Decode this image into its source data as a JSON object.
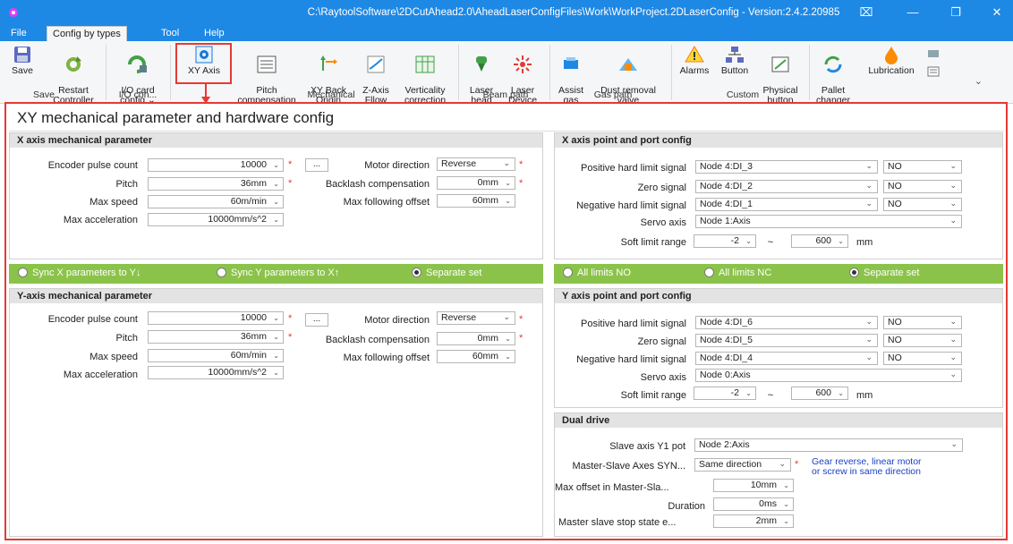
{
  "window": {
    "title": "C:\\RaytoolSoftware\\2DCutAhead2.0\\AheadLaserConfigFiles\\Work\\WorkProject.2DLaserConfig - Version:2.4.2.20985",
    "btn_restore_alt": "⌧",
    "btn_minimize": "—",
    "btn_maximize": "❐",
    "btn_close": "✕"
  },
  "menu": [
    "File",
    "Config by types",
    "Tool",
    "Help"
  ],
  "ribbon": {
    "buttons": {
      "save": "Save",
      "restart": "Restart\nController",
      "io_card": "I/O card\nconfig ⌄",
      "xy_axis": "XY Axis",
      "pitch_comp": "Pitch\ncompensation",
      "xy_back": "XY Back\nOrigin",
      "z_axis": "Z-Axis\nFllow",
      "verticality": "Verticality\ncorrection",
      "laser_head": "Laser\nhead",
      "laser_device": "Laser\nDevice",
      "assist_gas": "Assist\ngas",
      "dust_removal": "Dust removal\nvalve",
      "alarms": "Alarms",
      "button": "Button",
      "physical_button": "Physical\nbutton",
      "pallet_changer": "Pallet\nchanger",
      "lubrication": "Lubrication"
    },
    "groups": {
      "save": "Save",
      "io": "I/O con...",
      "mechanical": "Mechanical",
      "beam_path": "Beam path",
      "gas_path": "Gas path",
      "custom": "Custom"
    },
    "collapse": "⌄"
  },
  "page_title": "XY mechanical parameter and hardware config",
  "x_mech": {
    "header": "X axis mechanical parameter",
    "encoder_label": "Encoder pulse count",
    "encoder_value": "10000",
    "dots": "...",
    "motor_dir_label": "Motor direction",
    "motor_dir_value": "Reverse",
    "pitch_label": "Pitch",
    "pitch_value": "36mm",
    "backlash_label": "Backlash compensation",
    "backlash_value": "0mm",
    "max_speed_label": "Max speed",
    "max_speed_value": "60m/min",
    "max_follow_label": "Max following offset",
    "max_follow_value": "60mm",
    "max_acc_label": "Max acceleration",
    "max_acc_value": "10000mm/s^2"
  },
  "x_port": {
    "header": "X axis point and port config",
    "pos_label": "Positive hard limit signal",
    "pos_value": "Node 4:DI_3",
    "pos_mode": "NO",
    "zero_label": "Zero signal",
    "zero_value": "Node 4:DI_2",
    "zero_mode": "NO",
    "neg_label": "Negative hard limit signal",
    "neg_value": "Node 4:DI_1",
    "neg_mode": "NO",
    "servo_label": "Servo axis",
    "servo_value": "Node 1:Axis",
    "soft_label": "Soft limit range",
    "soft_min": "-2",
    "soft_sep": "~",
    "soft_max": "600",
    "soft_unit": "mm"
  },
  "sync_bar": {
    "opt1": "Sync X parameters to Y↓",
    "opt2": "Sync Y parameters to X↑",
    "opt3": "Separate set",
    "selected": 3
  },
  "limits_bar": {
    "opt1": "All limits NO",
    "opt2": "All limits NC",
    "opt3": "Separate set",
    "selected": 3
  },
  "y_mech": {
    "header": "Y-axis mechanical parameter",
    "encoder_label": "Encoder pulse count",
    "encoder_value": "10000",
    "dots": "...",
    "motor_dir_label": "Motor direction",
    "motor_dir_value": "Reverse",
    "pitch_label": "Pitch",
    "pitch_value": "36mm",
    "backlash_label": "Backlash compensation",
    "backlash_value": "0mm",
    "max_speed_label": "Max speed",
    "max_speed_value": "60m/min",
    "max_follow_label": "Max following offset",
    "max_follow_value": "60mm",
    "max_acc_label": "Max acceleration",
    "max_acc_value": "10000mm/s^2"
  },
  "y_port": {
    "header": "Y axis point and port config",
    "pos_label": "Positive hard limit signal",
    "pos_value": "Node 4:DI_6",
    "pos_mode": "NO",
    "zero_label": "Zero signal",
    "zero_value": "Node 4:DI_5",
    "zero_mode": "NO",
    "neg_label": "Negative hard limit signal",
    "neg_value": "Node 4:DI_4",
    "neg_mode": "NO",
    "servo_label": "Servo axis",
    "servo_value": "Node 0:Axis",
    "soft_label": "Soft limit range",
    "soft_min": "-2",
    "soft_sep": "~",
    "soft_max": "600",
    "soft_unit": "mm"
  },
  "dual_drive": {
    "header": "Dual drive",
    "slave_label": "Slave axis Y1 pot",
    "slave_value": "Node 2:Axis",
    "sync_label": "Master-Slave Axes SYN...",
    "sync_value": "Same direction",
    "sync_note": "Gear reverse, linear motor\nor screw in same direction",
    "max_offset_label": "Max offset in Master-Sla...",
    "max_offset_value": "10mm",
    "duration_label": "Duration",
    "duration_value": "0ms",
    "stop_label": "Master slave stop state e...",
    "stop_value": "2mm"
  },
  "colors": {
    "titlebar": "#1e88e5",
    "highlight_red": "#e53935",
    "green_bar": "#8bc34a",
    "required_red": "#e53935",
    "note_blue": "#1a3fc8"
  }
}
